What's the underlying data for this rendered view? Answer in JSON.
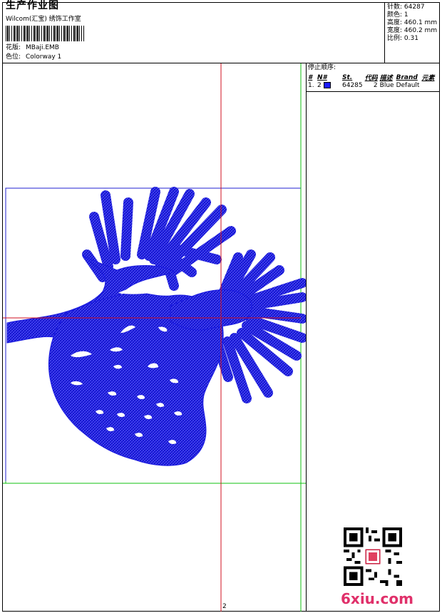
{
  "header": {
    "title": "生产作业图",
    "studio": "Wilcom(汇宝) 绣饰工作室",
    "design_label": "花版:",
    "design_value": "MBaji.EMB",
    "colorway_label": "色位:",
    "colorway_value": "Colorway 1"
  },
  "specs": [
    {
      "label": "针数:",
      "value": "64287"
    },
    {
      "label": "颜色:",
      "value": "1"
    },
    {
      "label": "高度:",
      "value": "460.1 mm"
    },
    {
      "label": "宽度:",
      "value": "460.2 mm"
    },
    {
      "label": "比例:",
      "value": "0.31"
    }
  ],
  "stop_sequence": {
    "title": "停止顺序:",
    "columns": [
      "#",
      "N#",
      "St.",
      "代码",
      "描述",
      "Brand",
      "元素"
    ],
    "rows": [
      {
        "index": "1.",
        "needle": "2",
        "stitches": "64285",
        "code": "2",
        "description": "Blue",
        "brand": "Default",
        "element": "",
        "color": "#1a1aff"
      }
    ]
  },
  "canvas": {
    "guide_label": "2",
    "thread_color": "#1a1ae0",
    "crosshair_color": "#d01020",
    "grid_color": "#10c010",
    "hoop_color": "#2020d0"
  },
  "watermark": {
    "text": "6xiu.com"
  }
}
